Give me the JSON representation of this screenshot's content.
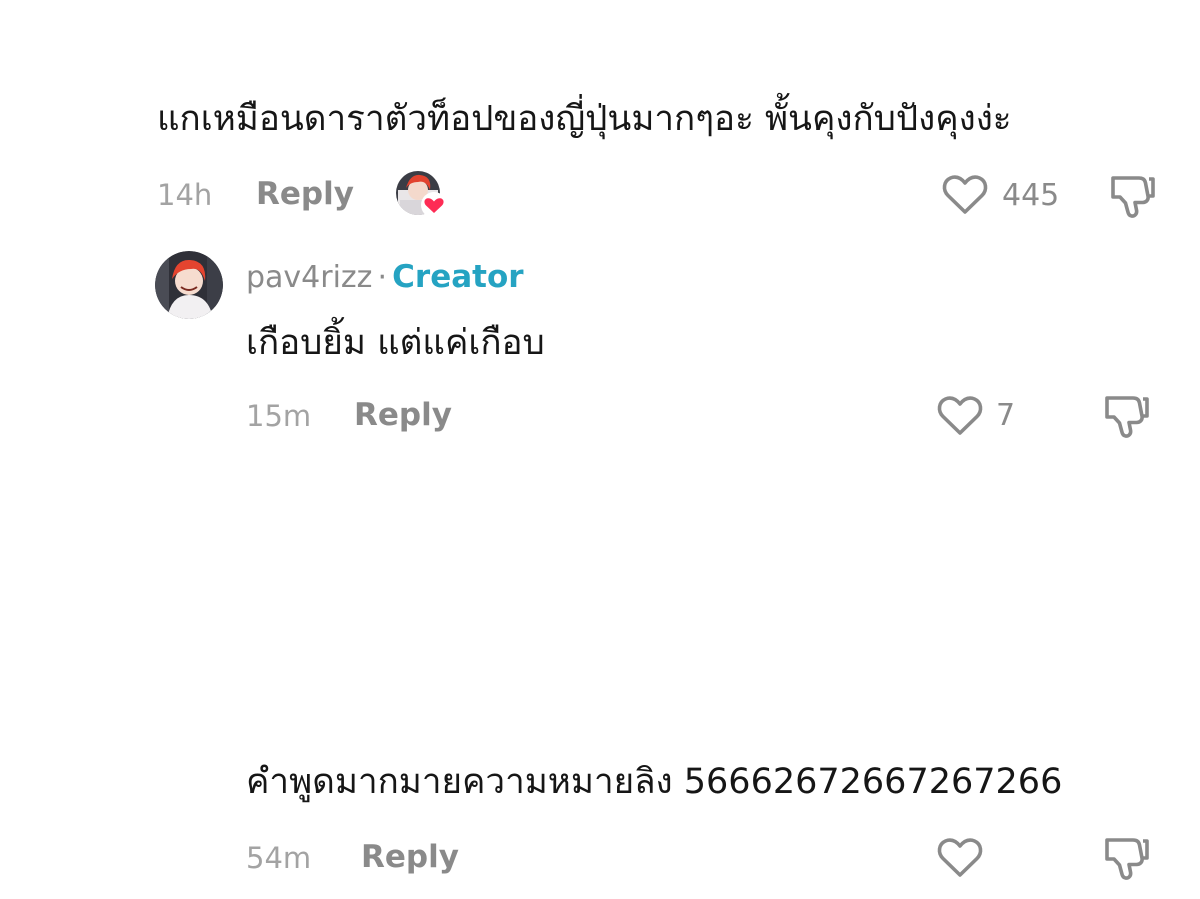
{
  "comments": [
    {
      "text": "แกเหมือนดาราตัวท็อปของญี่ปุ่นมากๆอะ พั้นคุงกับปังคุงง่ะ",
      "time": "14h",
      "reply_label": "Reply",
      "likes": "445",
      "creator_liked": true
    },
    {
      "username": "pav4rizz",
      "separator": "·",
      "badge": "Creator",
      "text": "เกือบยิ้ม แต่แค่เกือบ",
      "time": "15m",
      "reply_label": "Reply",
      "likes": "7"
    },
    {
      "text": "คำพูดมากมายความหมายลิง 56662672667267266",
      "time": "54m",
      "reply_label": "Reply",
      "likes": ""
    }
  ],
  "colors": {
    "text": "#161616",
    "meta": "#8a8a8a",
    "creator": "#25a3c2",
    "heart_badge": "#fe2c55"
  },
  "icons": {
    "like": "heart-outline-icon",
    "dislike": "thumbs-down-icon",
    "creator_liked": "heart-filled-icon"
  }
}
